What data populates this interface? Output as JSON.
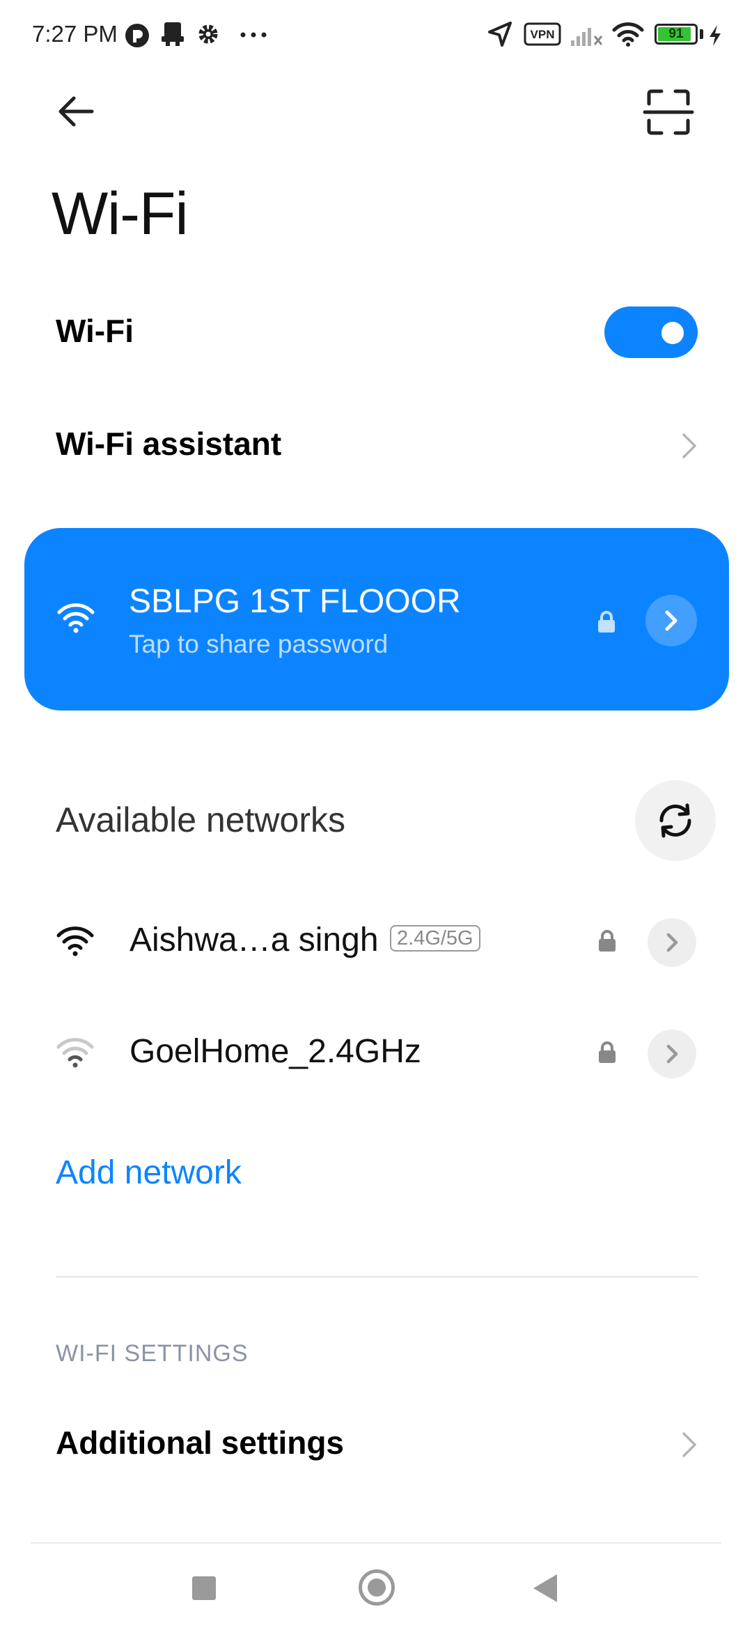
{
  "status_bar": {
    "time": "7:27 PM",
    "vpn_label": "VPN",
    "battery_level": "91",
    "battery_fraction": 0.91,
    "icons": [
      "notification-app-icon",
      "printer-icon",
      "settings-gear-icon",
      "more-dots-icon",
      "location-arrow-icon",
      "vpn-icon",
      "signal-no-service-icon",
      "wifi-icon",
      "battery-icon",
      "charging-bolt-icon"
    ]
  },
  "header": {
    "back_icon": "arrow-left-icon",
    "scan_icon": "scan-frame-icon",
    "title": "Wi-Fi"
  },
  "wifi_toggle": {
    "label": "Wi-Fi",
    "enabled": true
  },
  "wifi_assistant": {
    "label": "Wi-Fi assistant"
  },
  "connected_network": {
    "name": "SBLPG 1ST FLOOOR",
    "subtitle": "Tap to share password",
    "secured": true,
    "signal_bars": 4
  },
  "available_networks": {
    "title": "Available networks",
    "items": [
      {
        "name": "Aishwa…a singh",
        "band": "2.4G/5G",
        "secured": true,
        "signal_bars": 4
      },
      {
        "name": "GoelHome_2.4GHz",
        "band": "",
        "secured": true,
        "signal_bars": 2
      }
    ],
    "add_network_label": "Add network"
  },
  "wifi_settings": {
    "section_header": "WI-FI SETTINGS",
    "additional_settings_label": "Additional settings"
  },
  "colors": {
    "accent": "#0d84ff",
    "text_primary": "#000000",
    "section_header": "#8a93a6"
  }
}
